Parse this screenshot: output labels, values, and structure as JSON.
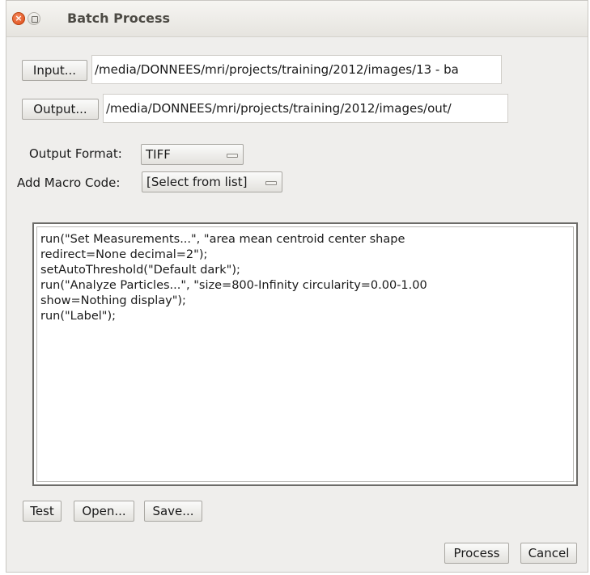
{
  "window": {
    "title": "Batch Process",
    "close_glyph": "×"
  },
  "input": {
    "button_label": "Input...",
    "path_value": "/media/DONNEES/mri/projects/training/2012/images/13 - ba"
  },
  "output": {
    "button_label": "Output...",
    "path_value": "/media/DONNEES/mri/projects/training/2012/images/out/"
  },
  "output_format": {
    "label": "Output Format:",
    "selected": "TIFF"
  },
  "macro_code": {
    "label": "Add Macro Code:",
    "selected": "[Select from list]"
  },
  "code_editor": {
    "lines": [
      "run(\"Set Measurements...\", \"area mean centroid center shape",
      "redirect=None decimal=2\");",
      "setAutoThreshold(\"Default dark\");",
      "run(\"Analyze Particles...\", \"size=800-Infinity circularity=0.00-1.00",
      "show=Nothing display\");",
      "run(\"Label\");"
    ]
  },
  "buttons": {
    "test": "Test",
    "open": "Open...",
    "save": "Save...",
    "process": "Process",
    "cancel": "Cancel"
  },
  "colors": {
    "window_bg": "#efeeec",
    "close_button": "#dd4814"
  }
}
